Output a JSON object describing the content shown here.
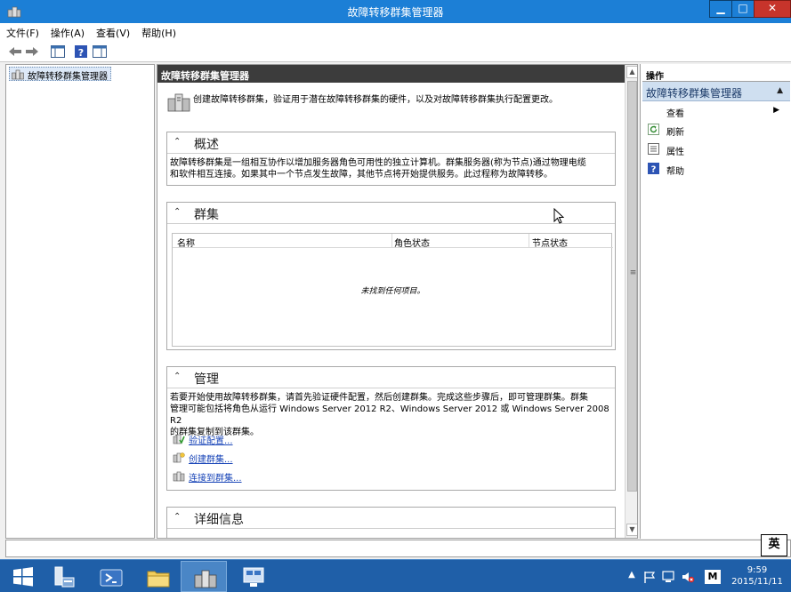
{
  "window": {
    "title": "故障转移群集管理器",
    "min_glyph": "▁",
    "max_glyph": "□",
    "close_glyph": "✕"
  },
  "menu": [
    "文件(F)",
    "操作(A)",
    "查看(V)",
    "帮助(H)"
  ],
  "tree": {
    "root_label": "故障转移群集管理器"
  },
  "center": {
    "header": "故障转移群集管理器",
    "intro": "创建故障转移群集，验证用于潜在故障转移群集的硬件，以及对故障转移群集执行配置更改。",
    "overview": {
      "title": "概述",
      "text": "故障转移群集是一组相互协作以增加服务器角色可用性的独立计算机。群集服务器(称为节点)通过物理电缆\n和软件相互连接。如果其中一个节点发生故障，其他节点将开始提供服务。此过程称为故障转移。"
    },
    "clusters": {
      "title": "群集",
      "columns": [
        "名称",
        "角色状态",
        "节点状态"
      ],
      "empty_text": "未找到任何项目。"
    },
    "management": {
      "title": "管理",
      "text": "若要开始使用故障转移群集，请首先验证硬件配置，然后创建群集。完成这些步骤后，即可管理群集。群集\n管理可能包括将角色从运行 Windows Server 2012 R2、Windows Server 2012 或 Windows Server 2008 R2\n的群集复制到该群集。",
      "links": [
        "验证配置...",
        "创建群集...",
        "连接到群集..."
      ]
    },
    "details": {
      "title": "详细信息"
    }
  },
  "actions": {
    "header": "操作",
    "group": "故障转移群集管理器",
    "items": [
      {
        "label": "查看",
        "submenu": "▶"
      },
      {
        "label": "刷新"
      },
      {
        "label": "属性"
      },
      {
        "label": "帮助"
      }
    ]
  },
  "ime": "英",
  "clock": {
    "time": "9:59",
    "date": "2015/11/11"
  },
  "tray": {
    "keyboard_indicator": "M"
  },
  "colors": {
    "titlebar": "#1c7fd6",
    "close_button": "#c7342b",
    "taskbar": "#1f5fa8",
    "link": "#1a46b8"
  }
}
